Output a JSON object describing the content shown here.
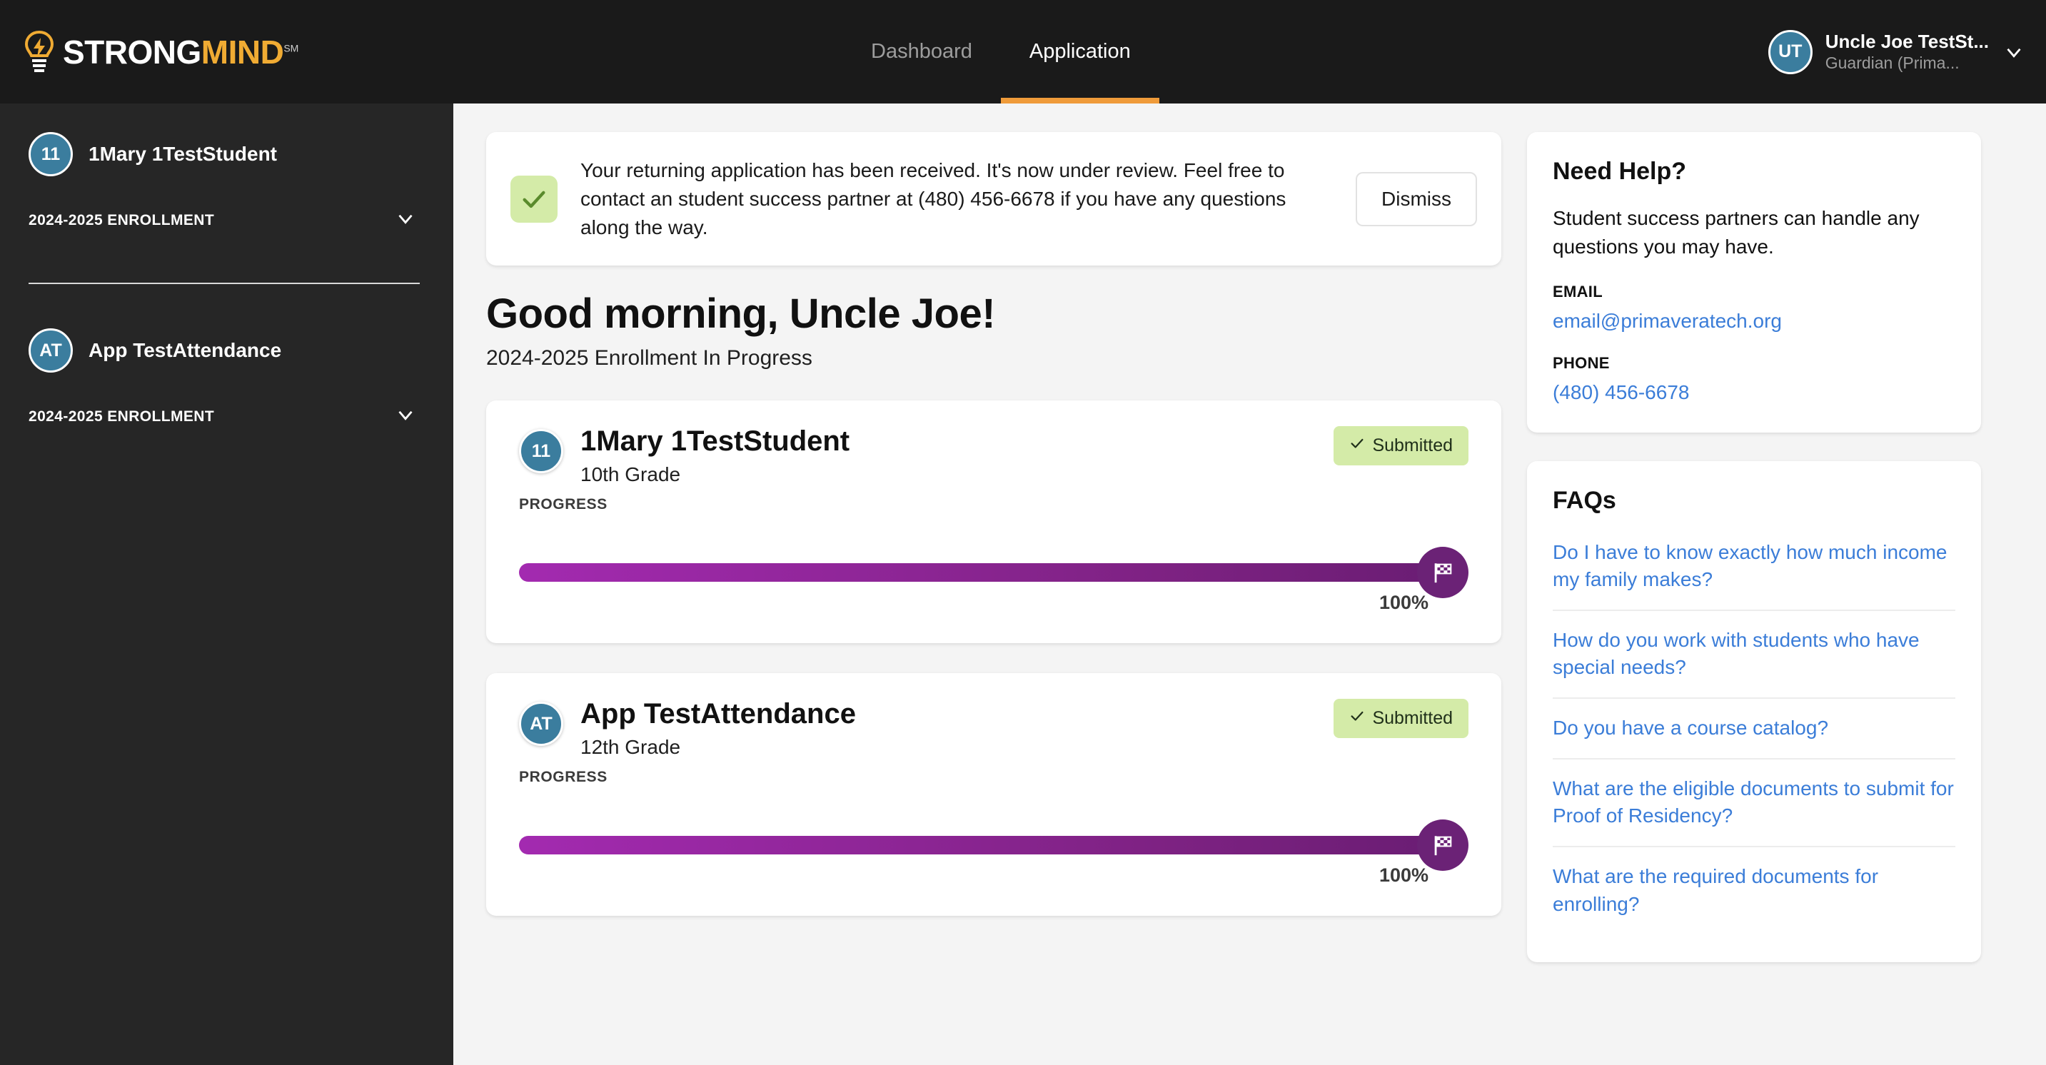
{
  "header": {
    "logo": {
      "strong": "STRONG",
      "mind": "MIND",
      "sm": "SM",
      "icon": "lightbulb-icon"
    },
    "nav": [
      {
        "label": "Dashboard",
        "active": false
      },
      {
        "label": "Application",
        "active": true
      }
    ],
    "user": {
      "initials": "UT",
      "name": "Uncle Joe TestSt...",
      "role": "Guardian (Prima...",
      "chevron": "chevron-down-icon"
    },
    "colors": {
      "bg": "#1a1a1a",
      "accent": "#ef9b3a",
      "avatar": "#3b7d9e"
    }
  },
  "sidebar": {
    "bg": "#262626",
    "students": [
      {
        "initials": "11",
        "name": "1Mary 1TestStudent",
        "enrollment_label": "2024-2025 ENROLLMENT"
      },
      {
        "initials": "AT",
        "name": "App TestAttendance",
        "enrollment_label": "2024-2025 ENROLLMENT"
      }
    ]
  },
  "main": {
    "alert": {
      "icon": "check-icon",
      "message": "Your returning application has been received. It's now under review. Feel free to contact an student success partner at (480) 456-6678 if you have any questions along the way.",
      "dismiss_label": "Dismiss",
      "icon_bg": "#d4eba8"
    },
    "greeting": "Good morning, Uncle Joe!",
    "subtitle": "2024-2025 Enrollment In Progress",
    "progress_label": "PROGRESS",
    "students": [
      {
        "initials": "11",
        "name": "1Mary 1TestStudent",
        "grade": "10th Grade",
        "status": "Submitted",
        "status_icon": "check-icon",
        "progress_percent": "100%",
        "progress_value": 100,
        "knob_icon": "checkered-flag-icon"
      },
      {
        "initials": "AT",
        "name": "App TestAttendance",
        "grade": "12th Grade",
        "status": "Submitted",
        "status_icon": "check-icon",
        "progress_percent": "100%",
        "progress_value": 100,
        "knob_icon": "checkered-flag-icon"
      }
    ]
  },
  "rail": {
    "help": {
      "title": "Need Help?",
      "body": "Student success partners can handle any questions you may have.",
      "email_label": "EMAIL",
      "email": "email@primaveratech.org",
      "phone_label": "PHONE",
      "phone": "(480) 456-6678"
    },
    "faqs": {
      "title": "FAQs",
      "items": [
        "Do I have to know exactly how much income my family makes?",
        "How do you work with students who have special needs?",
        "Do you have a course catalog?",
        "What are the eligible documents to submit for Proof of Residency?",
        "What are the required documents for enrolling?"
      ]
    }
  }
}
